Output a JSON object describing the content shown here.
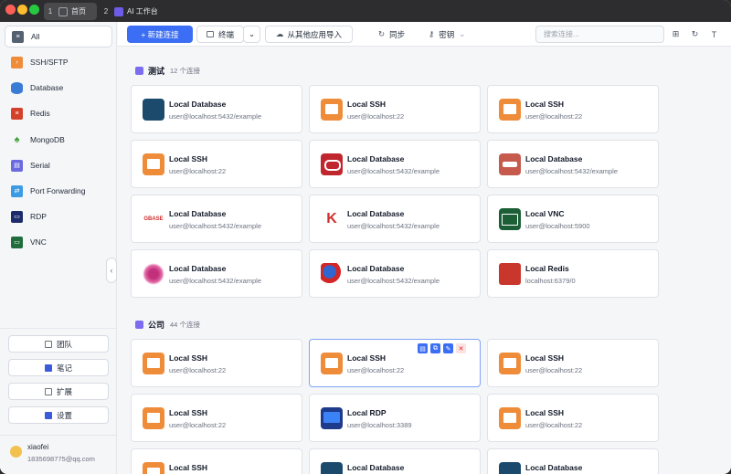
{
  "titlebar": {
    "tabs": [
      {
        "num": "1",
        "label": "首页"
      },
      {
        "num": "2",
        "label": "AI 工作台"
      }
    ]
  },
  "sidebar": {
    "items": [
      {
        "label": "All",
        "icon": "grid-icon"
      },
      {
        "label": "SSH/SFTP",
        "icon": "terminal-icon"
      },
      {
        "label": "Database",
        "icon": "database-icon"
      },
      {
        "label": "Redis",
        "icon": "redis-icon"
      },
      {
        "label": "MongoDB",
        "icon": "mongodb-leaf-icon"
      },
      {
        "label": "Serial",
        "icon": "serial-icon"
      },
      {
        "label": "Port Forwarding",
        "icon": "port-forwarding-icon"
      },
      {
        "label": "RDP",
        "icon": "rdp-monitor-icon"
      },
      {
        "label": "VNC",
        "icon": "vnc-monitor-icon"
      }
    ],
    "buttons": {
      "team": "团队",
      "notes": "笔记",
      "extensions": "扩展",
      "settings": "设置"
    },
    "user": {
      "name": "xiaofei",
      "email": "1835698775@qq.com"
    }
  },
  "toolbar": {
    "new_connection": "+ 新建连接",
    "terminal": "终端",
    "import": "从其他应用导入",
    "sync": "同步",
    "key": "密钥",
    "search_placeholder": "搜索连接..."
  },
  "groups": [
    {
      "name": "测试",
      "count": "12 个连接",
      "cards": [
        {
          "title": "Local Database",
          "sub": "user@localhost:5432/example",
          "icon": "postgresql-icon"
        },
        {
          "title": "Local SSH",
          "sub": "user@localhost:22",
          "icon": "ssh-terminal-icon"
        },
        {
          "title": "Local SSH",
          "sub": "user@localhost:22",
          "icon": "ssh-terminal-icon"
        },
        {
          "title": "Local SSH",
          "sub": "user@localhost:22",
          "icon": "ssh-terminal-icon"
        },
        {
          "title": "Local Database",
          "sub": "user@localhost:5432/example",
          "icon": "oracle-icon"
        },
        {
          "title": "Local Database",
          "sub": "user@localhost:5432/example",
          "icon": "database-red-icon"
        },
        {
          "title": "Local Database",
          "sub": "user@localhost:5432/example",
          "icon": "gbase-icon",
          "icon_text": "GBASE"
        },
        {
          "title": "Local Database",
          "sub": "user@localhost:5432/example",
          "icon": "kingbase-icon",
          "icon_text": "K"
        },
        {
          "title": "Local VNC",
          "sub": "user@localhost:5900",
          "icon": "vnc-monitor-icon"
        },
        {
          "title": "Local Database",
          "sub": "user@localhost:5432/example",
          "icon": "burst-db-icon"
        },
        {
          "title": "Local Database",
          "sub": "user@localhost:5432/example",
          "icon": "globe-db-icon"
        },
        {
          "title": "Local Redis",
          "sub": "localhost:6379/0",
          "icon": "redis-icon"
        }
      ]
    },
    {
      "name": "公司",
      "count": "44 个连接",
      "cards": [
        {
          "title": "Local SSH",
          "sub": "user@localhost:22",
          "icon": "ssh-terminal-icon"
        },
        {
          "title": "Local SSH",
          "sub": "user@localhost:22",
          "icon": "ssh-terminal-icon"
        },
        {
          "title": "Local SSH",
          "sub": "user@localhost:22",
          "icon": "ssh-terminal-icon"
        },
        {
          "title": "Local SSH",
          "sub": "user@localhost:22",
          "icon": "ssh-terminal-icon"
        },
        {
          "title": "Local RDP",
          "sub": "user@localhost:3389",
          "icon": "rdp-monitor-icon"
        },
        {
          "title": "Local SSH",
          "sub": "user@localhost:22",
          "icon": "ssh-terminal-icon"
        },
        {
          "title": "Local SSH",
          "sub": "",
          "icon": "ssh-terminal-icon"
        },
        {
          "title": "Local Database",
          "sub": "",
          "icon": "postgresql-icon"
        },
        {
          "title": "Local Database",
          "sub": "",
          "icon": "postgresql-icon"
        }
      ]
    }
  ],
  "colors": {
    "accent": "#3b6ef5",
    "ssh": "#ef8c3a",
    "oracle": "#c0262d",
    "redis": "#c9372c"
  }
}
